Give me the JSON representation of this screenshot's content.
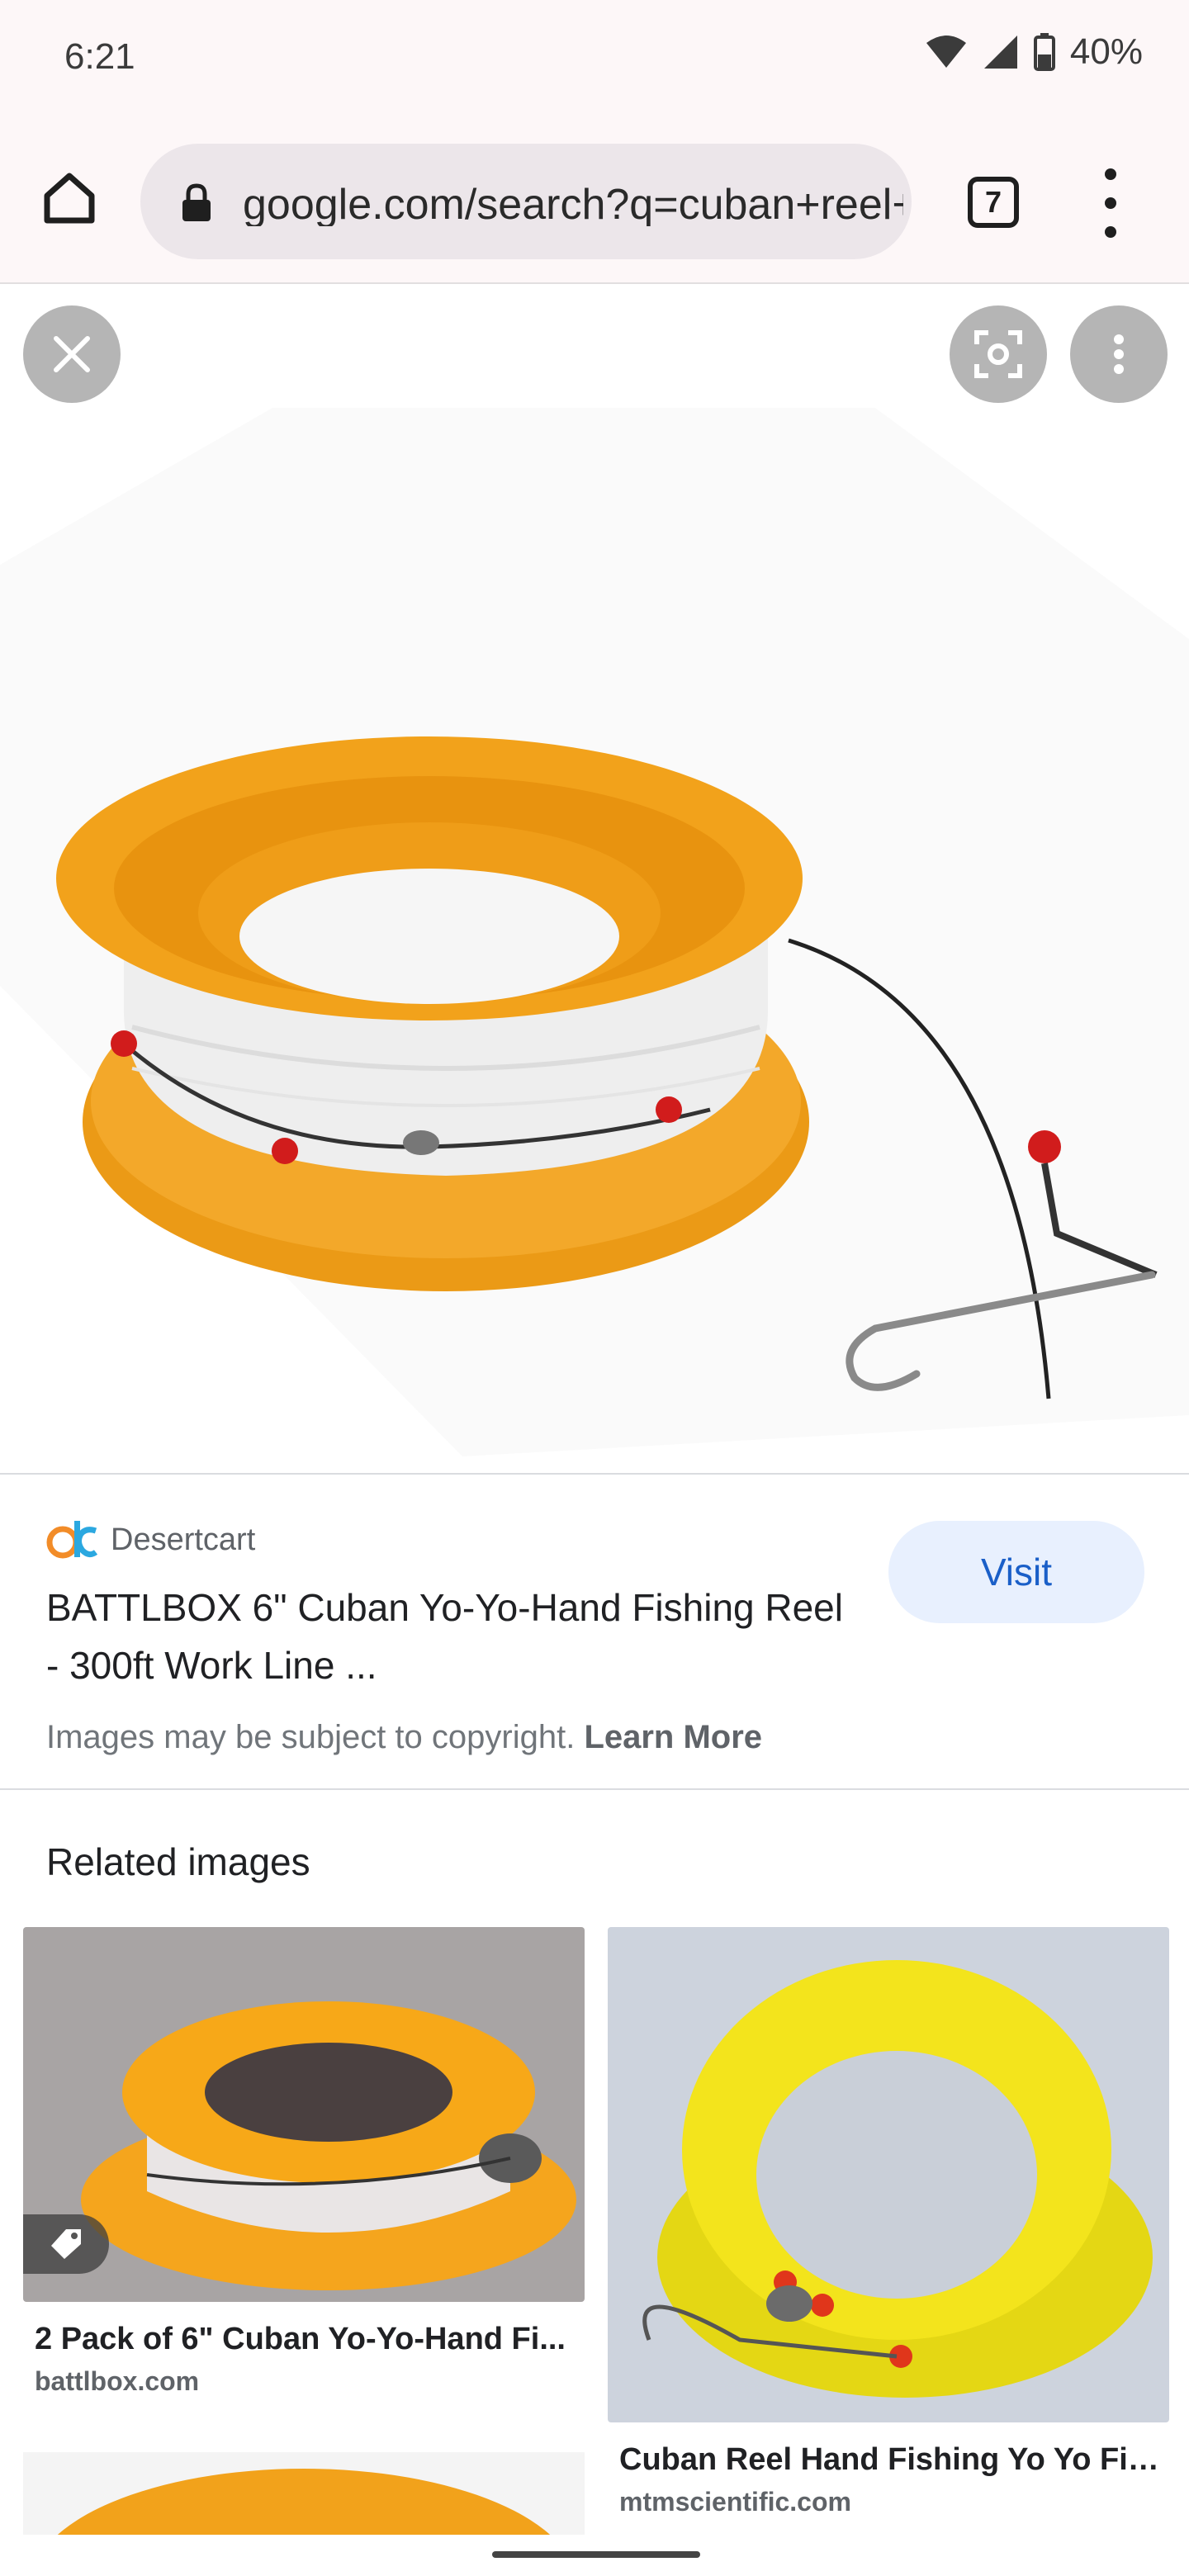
{
  "status_bar": {
    "time": "6:21",
    "battery": "40%",
    "icons": [
      "wifi-icon",
      "cell-signal-icon",
      "battery-icon"
    ]
  },
  "browser": {
    "url": "google.com/search?q=cuban+reel+hand+fishing",
    "tab_count": "7",
    "icons": [
      "home-icon",
      "lock-icon",
      "overflow-menu-icon"
    ]
  },
  "viewer": {
    "icons": [
      "close-icon",
      "lens-icon",
      "more-vert-icon"
    ],
    "image_subject": "orange Cuban yo-yo hand fishing reel with line and hook"
  },
  "result": {
    "source": "Desertcart",
    "title": "BATTLBOX 6\" Cuban Yo-Yo-Hand Fishing Reel - 300ft Work Line ...",
    "visit_label": "Visit",
    "copyright_text": "Images may be subject to copyright.",
    "learn_more": "Learn More"
  },
  "related": {
    "heading": "Related images",
    "items": [
      {
        "title": "2 Pack of 6\" Cuban Yo-Yo-Hand Fi...",
        "domain": "battlbox.com",
        "badge_icon": "tag-icon"
      },
      {
        "title": "Cuban Reel Hand Fishing Yo Yo Fis...",
        "domain": "mtmscientific.com"
      }
    ]
  },
  "colors": {
    "accent_blue": "#1a5fc8",
    "visit_bg": "#e8f0fe",
    "reel_orange": "#f2a21b",
    "reel_yellow": "#f3e41c"
  }
}
